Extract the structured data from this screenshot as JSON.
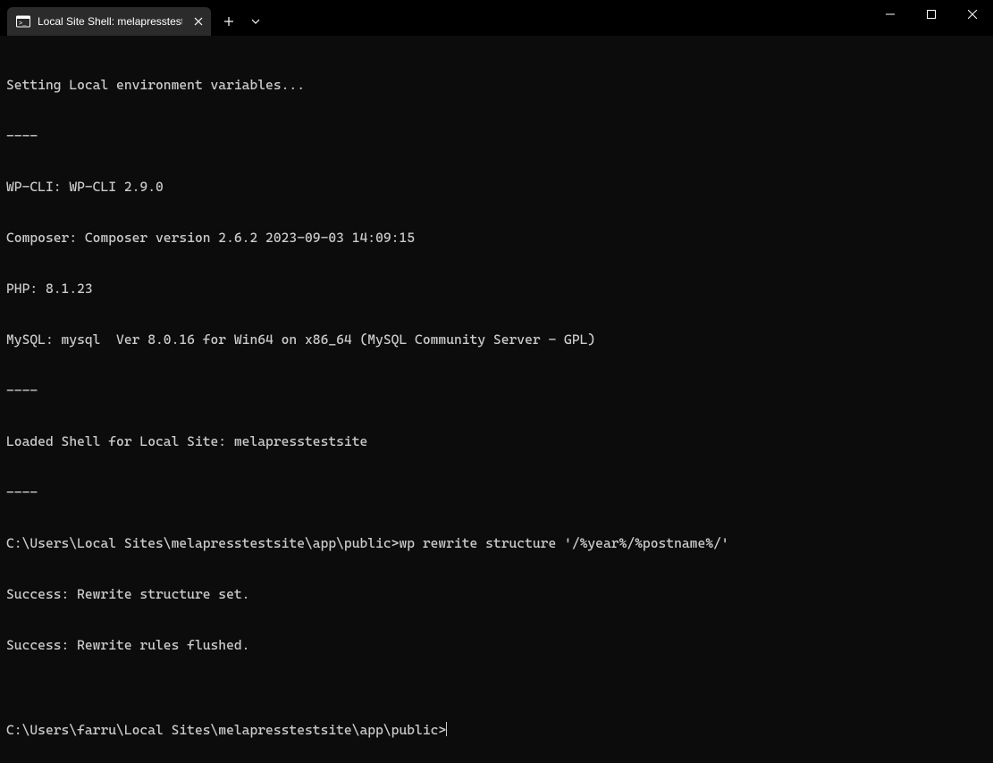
{
  "titlebar": {
    "tab_title": "Local Site Shell: melapresstest"
  },
  "terminal": {
    "lines": [
      "Setting Local environment variables...",
      "----",
      "WP-CLI: WP-CLI 2.9.0",
      "Composer: Composer version 2.6.2 2023-09-03 14:09:15",
      "PHP: 8.1.23",
      "MySQL: mysql  Ver 8.0.16 for Win64 on x86_64 (MySQL Community Server - GPL)",
      "----",
      "Loaded Shell for Local Site: melapresstestsite",
      "----",
      "C:\\Users\\Local Sites\\melapresstestsite\\app\\public>wp rewrite structure '/%year%/%postname%/'",
      "Success: Rewrite structure set.",
      "Success: Rewrite rules flushed.",
      ""
    ],
    "prompt": "C:\\Users\\farru\\Local Sites\\melapresstestsite\\app\\public>"
  }
}
